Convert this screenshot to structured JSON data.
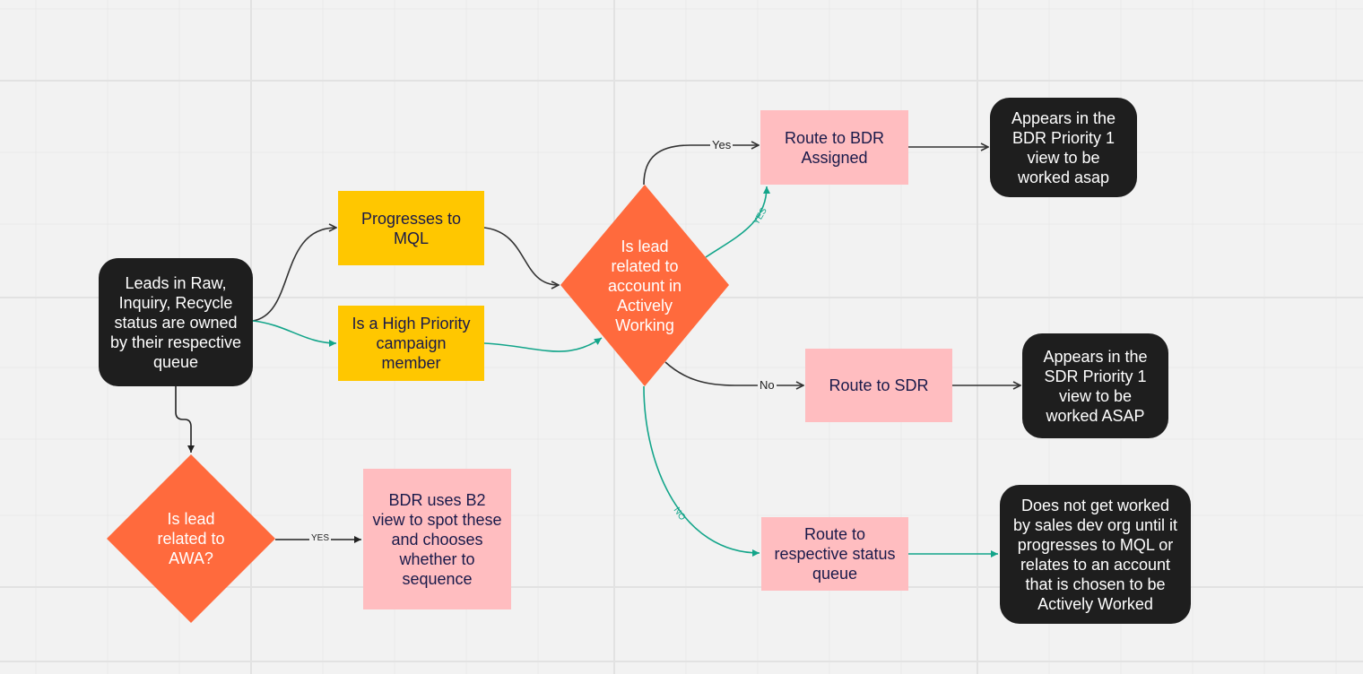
{
  "colors": {
    "black_node": "#1e1e1e",
    "yellow_node": "#ffc700",
    "pink_node": "#ffbdc0",
    "decision": "#ff6a3d",
    "teal_edge": "#13a58a",
    "dark_edge": "#333333",
    "background": "#f2f2f2"
  },
  "nodes": {
    "leads": "Leads in Raw, Inquiry, Recycle status are owned by their respective queue",
    "mql": "Progresses to MQL",
    "high_priority": "Is a High Priority campaign member",
    "decision_active": "Is lead related to account in Actively Working",
    "route_bdr": "Route to BDR Assigned",
    "appears_bdr": "Appears in the BDR Priority 1 view to be worked asap",
    "route_sdr": "Route to SDR",
    "appears_sdr": "Appears in the SDR Priority 1 view to be worked ASAP",
    "route_status": "Route to respective status queue",
    "not_worked": "Does not get worked by sales dev org until it progresses to MQL or relates to an account that is chosen to be Actively Worked",
    "decision_awa": "Is lead related to AWA?",
    "bdr_b2": "BDR uses B2 view to spot these and chooses whether to sequence"
  },
  "edge_labels": {
    "yes_bdr": "Yes",
    "yes_teal": "YES",
    "no_sdr": "No",
    "no_teal": "NO",
    "yes_awa": "YES"
  }
}
